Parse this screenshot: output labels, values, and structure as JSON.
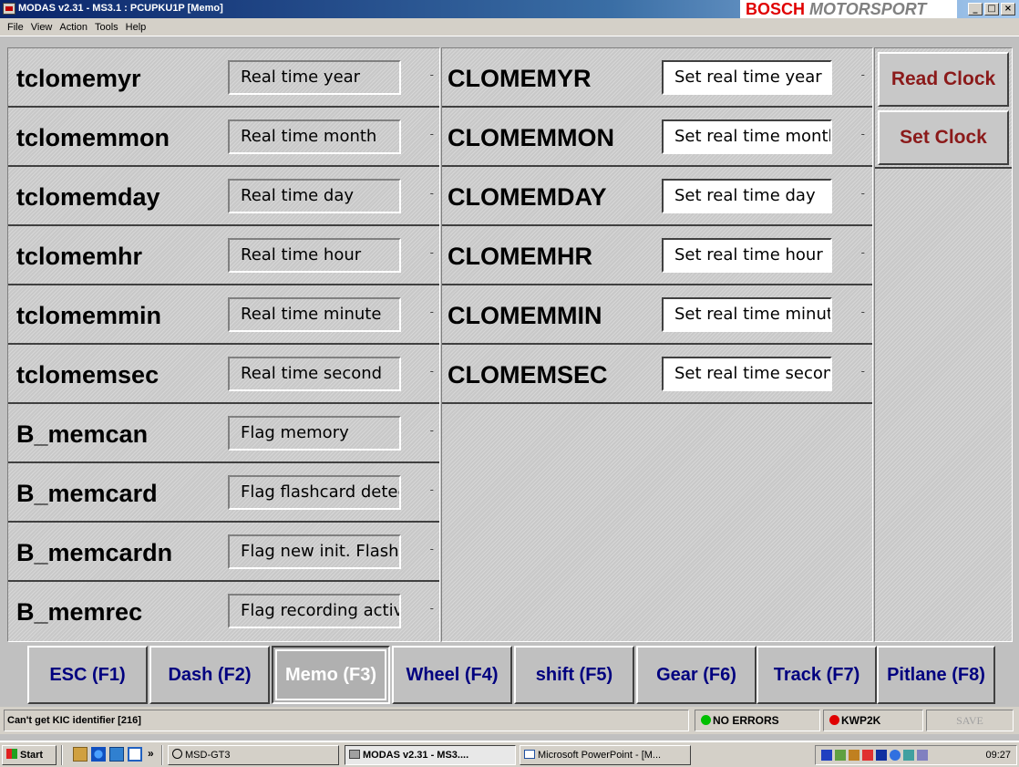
{
  "window": {
    "title": "MODAS v2.31 - MS3.1 : PCUPKU1P   [Memo]",
    "brand_left": "BOSCH",
    "brand_right": "MOTORSPORT",
    "controls": [
      "_",
      "□",
      "×"
    ]
  },
  "menu": [
    "File",
    "View",
    "Action",
    "Tools",
    "Help"
  ],
  "left_rows": [
    {
      "name": "tclomemyr",
      "value": "Real time year"
    },
    {
      "name": "tclomemmon",
      "value": "Real time month"
    },
    {
      "name": "tclomemday",
      "value": "Real time day"
    },
    {
      "name": "tclomemhr",
      "value": "Real time hour"
    },
    {
      "name": "tclomemmin",
      "value": "Real time minute"
    },
    {
      "name": "tclomemsec",
      "value": "Real time second"
    },
    {
      "name": "B_memcan",
      "value": "Flag memory"
    },
    {
      "name": "B_memcard",
      "value": "Flag flashcard detect."
    },
    {
      "name": "B_memcardn",
      "value": "Flag new init. Flashc."
    },
    {
      "name": "B_memrec",
      "value": "Flag recording active"
    }
  ],
  "mid_rows": [
    {
      "name": "CLOMEMYR",
      "value": "Set real time year"
    },
    {
      "name": "CLOMEMMON",
      "value": "Set real time month"
    },
    {
      "name": "CLOMEMDAY",
      "value": "Set real time day"
    },
    {
      "name": "CLOMEMHR",
      "value": "Set real time hour"
    },
    {
      "name": "CLOMEMMIN",
      "value": "Set real time minute"
    },
    {
      "name": "CLOMEMSEC",
      "value": "Set real time second"
    }
  ],
  "row_unit": "-",
  "side_buttons": [
    "Read Clock",
    "Set Clock"
  ],
  "fkeys": [
    "ESC (F1)",
    "Dash (F2)",
    "Memo (F3)",
    "Wheel  (F4)",
    "shift  (F5)",
    "Gear  (F6)",
    "Track  (F7)",
    "Pitlane (F8)"
  ],
  "active_fkey": "Memo (F3)",
  "status": {
    "message": "Can't get KIC identifier [216]",
    "errors": "NO ERRORS",
    "errors_color": "#00c000",
    "protocol": "KWP2K",
    "protocol_color": "#e00000",
    "save": "SAVE"
  },
  "taskbar": {
    "start": "Start",
    "overflow": "»",
    "items": [
      "MSD-GT3",
      "MODAS v2.31 - MS3....",
      "Microsoft PowerPoint - [M..."
    ],
    "clock": "09:27"
  }
}
